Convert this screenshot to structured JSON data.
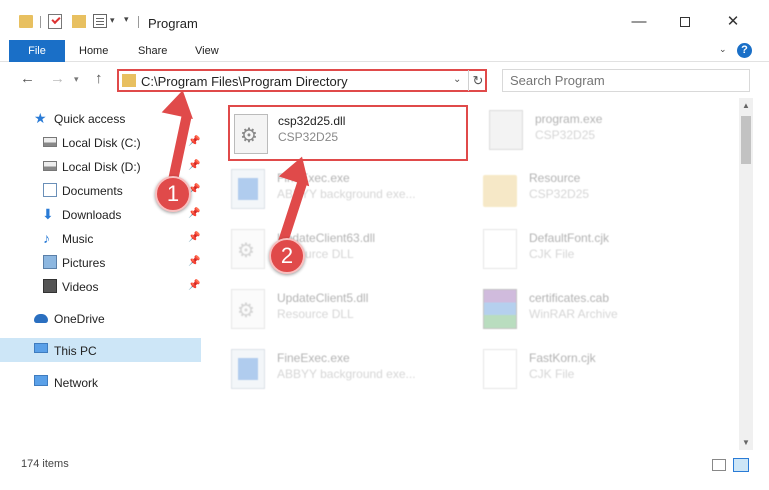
{
  "window": {
    "title": "Program",
    "minimize": "—",
    "close": "✕"
  },
  "ribbon": {
    "tabs": [
      "File",
      "Home",
      "Share",
      "View"
    ],
    "help": "?"
  },
  "address_bar": {
    "path": "C:\\Program Files\\Program Directory"
  },
  "search": {
    "placeholder": "Search Program"
  },
  "nav_pane": {
    "items": [
      {
        "label": "Quick access",
        "icon": "star-icon",
        "pinned": false
      },
      {
        "label": "Local Disk (C:)",
        "icon": "drive-icon",
        "pinned": true
      },
      {
        "label": "Local Disk (D:)",
        "icon": "drive-icon",
        "pinned": true
      },
      {
        "label": "Documents",
        "icon": "documents-icon",
        "pinned": true
      },
      {
        "label": "Downloads",
        "icon": "download-icon",
        "pinned": true
      },
      {
        "label": "Music",
        "icon": "music-icon",
        "pinned": true
      },
      {
        "label": "Pictures",
        "icon": "pictures-icon",
        "pinned": true
      },
      {
        "label": "Videos",
        "icon": "videos-icon",
        "pinned": true
      },
      {
        "label": "OneDrive",
        "icon": "onedrive-icon",
        "pinned": false
      },
      {
        "label": "This PC",
        "icon": "this-pc-icon",
        "pinned": false,
        "selected": true
      },
      {
        "label": "Network",
        "icon": "network-icon",
        "pinned": false
      }
    ]
  },
  "files": [
    {
      "name": "csp32d25.dll",
      "desc": "CSP32D25",
      "icon": "dll-gear-icon",
      "highlighted": true
    },
    {
      "name": "program.exe",
      "desc": "CSP32D25",
      "icon": "program-icon"
    },
    {
      "name": "FineExec.exe",
      "desc": "ABBYY background exe...",
      "icon": "exe-icon"
    },
    {
      "name": "Resource",
      "desc": "CSP32D25",
      "icon": "folder-icon"
    },
    {
      "name": "UpdateClient63.dll",
      "desc": "Resource DLL",
      "icon": "dll-gear-icon"
    },
    {
      "name": "DefaultFont.cjk",
      "desc": "CJK File",
      "icon": "file-icon"
    },
    {
      "name": "UpdateClient5.dll",
      "desc": "Resource DLL",
      "icon": "dll-gear-icon"
    },
    {
      "name": "certificates.cab",
      "desc": "WinRAR Archive",
      "icon": "archive-icon"
    },
    {
      "name": "FineExec.exe",
      "desc": "ABBYY background exe...",
      "icon": "exe-icon"
    },
    {
      "name": "FastKorn.cjk",
      "desc": "CJK File",
      "icon": "file-icon"
    }
  ],
  "status_bar": {
    "item_count": "174 items"
  },
  "annotations": {
    "step1": "1",
    "step2": "2",
    "color": "#e04a4a"
  },
  "colors": {
    "accent": "#1a6fc7",
    "selection": "#cde6f7",
    "highlight": "#e04a4a"
  }
}
